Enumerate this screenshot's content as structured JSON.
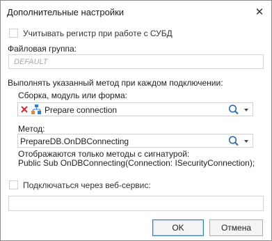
{
  "dialog": {
    "title": "Дополнительные настройки",
    "close_glyph": "✕"
  },
  "case_sensitive": {
    "label": "Учитывать регистр при работе с СУБД",
    "checked": false
  },
  "file_group": {
    "label": "Файловая группа:",
    "placeholder": "DEFAULT",
    "value": ""
  },
  "execute_method": {
    "heading": "Выполнять указанный метод при каждом подключении:",
    "assembly_label": "Сборка, модуль или форма:",
    "assembly_value": "Prepare connection",
    "method_label": "Метод:",
    "method_value": "PrepareDB.OnDBConnecting",
    "signature_hint_line1": "Отображаются только методы с сигнатурой:",
    "signature_hint_line2": "Public Sub OnDBConnecting(Connection: ISecurityConnection);"
  },
  "web_service": {
    "label": "Подключаться через веб-сервис:",
    "checked": false,
    "value": ""
  },
  "buttons": {
    "ok": "OK",
    "cancel": "Отмена"
  },
  "icons": {
    "clear": "red-x-icon",
    "assembly": "assembly-tree-icon",
    "search": "magnifier-icon",
    "dropdown": "chevron-down-icon"
  },
  "colors": {
    "clear_icon": "#d9262a",
    "assembly_icon_blue": "#2f7fd1",
    "assembly_icon_orange": "#f08a1c",
    "search_icon": "#2b6cb3",
    "ok_border": "#3c7fb1"
  }
}
